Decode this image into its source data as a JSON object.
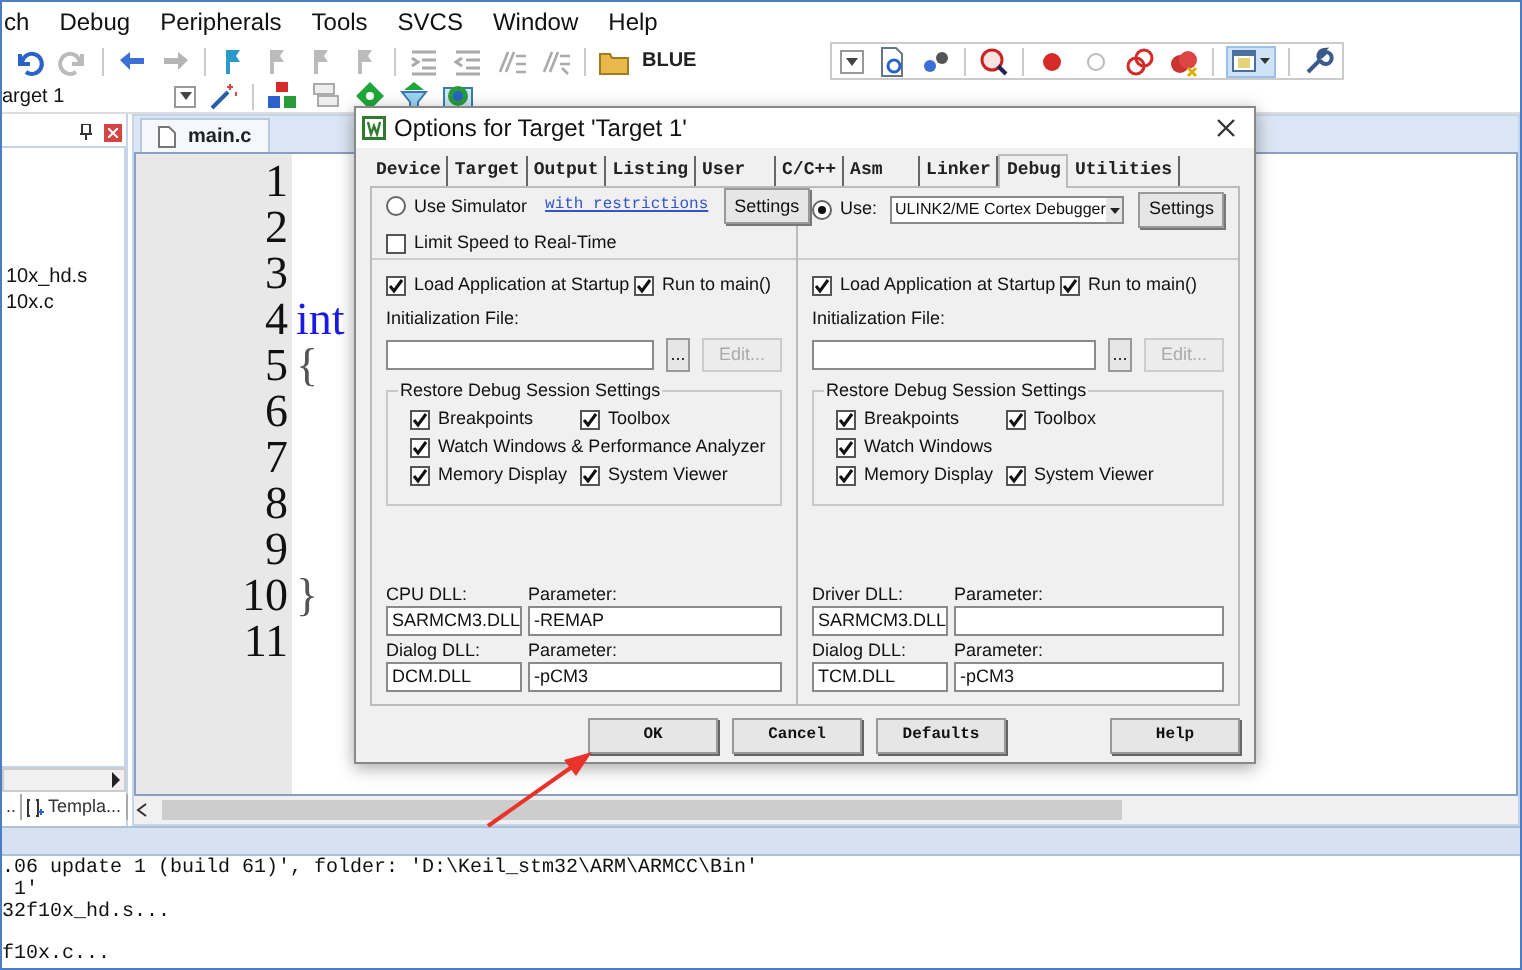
{
  "menu": [
    "ch",
    "Debug",
    "Peripherals",
    "Tools",
    "SVCS",
    "Window",
    "Help"
  ],
  "toolbar": {
    "target_label": "BLUE"
  },
  "target_select": {
    "value": "arget 1"
  },
  "project_panel": {
    "files": [
      "10x_hd.s",
      "10x.c"
    ],
    "tabs": [
      "..",
      "Templa..."
    ]
  },
  "editor": {
    "tab": "main.c",
    "lines": [
      {
        "number": "1"
      },
      {
        "number": "2"
      },
      {
        "number": "3"
      },
      {
        "number": "4",
        "code": "int",
        "kind": "keyword"
      },
      {
        "number": "5",
        "code": "{",
        "kind": "punct"
      },
      {
        "number": "6"
      },
      {
        "number": "7"
      },
      {
        "number": "8"
      },
      {
        "number": "9"
      },
      {
        "number": "10",
        "code": "}",
        "kind": "punct"
      },
      {
        "number": "11"
      }
    ]
  },
  "output": {
    "lines": [
      ".06 update 1 (build 61)', folder: 'D:\\Keil_stm32\\ARM\\ARMCC\\Bin'",
      " 1'",
      "32f10x_hd.s...",
      "f10x.c..."
    ]
  },
  "dialog": {
    "title": "Options for Target 'Target 1'",
    "tabs": [
      {
        "label": "Device",
        "selected": false
      },
      {
        "label": "Target",
        "selected": false
      },
      {
        "label": "Output",
        "selected": false
      },
      {
        "label": "Listing",
        "selected": false
      },
      {
        "label": "User",
        "selected": false
      },
      {
        "label": "C/C++",
        "selected": false
      },
      {
        "label": "Asm",
        "selected": false
      },
      {
        "label": "Linker",
        "selected": false
      },
      {
        "label": "Debug",
        "selected": true
      },
      {
        "label": "Utilities",
        "selected": false
      }
    ],
    "panes": [
      {
        "kind": "simulator",
        "radio": {
          "label": "Use Simulator",
          "selected": false
        },
        "link": "with restrictions",
        "settings": "Settings",
        "limit_speed": {
          "label": "Limit Speed to Real-Time",
          "checked": false
        },
        "load_app": {
          "label": "Load Application at Startup",
          "checked": true
        },
        "run_main": {
          "label": "Run to main()",
          "checked": true
        },
        "init_label": "Initialization File:",
        "browse": "...",
        "edit": {
          "label": "Edit...",
          "disabled": true
        },
        "restore": {
          "title": "Restore Debug Session Settings",
          "rows": [
            [
              {
                "label": "Breakpoints",
                "checked": true
              },
              {
                "label": "Toolbox",
                "checked": true
              }
            ],
            [
              {
                "label": "Watch Windows & Performance Analyzer",
                "checked": true
              }
            ],
            [
              {
                "label": "Memory Display",
                "checked": true
              },
              {
                "label": "System Viewer",
                "checked": true
              }
            ]
          ]
        },
        "dlls": [
          {
            "label": "CPU DLL:",
            "value": "SARMCM3.DLL",
            "param_label": "Parameter:",
            "param": "-REMAP"
          },
          {
            "label": "Dialog DLL:",
            "value": "DCM.DLL",
            "param_label": "Parameter:",
            "param": "-pCM3"
          }
        ]
      },
      {
        "kind": "target",
        "radio": {
          "label": "Use:",
          "selected": true
        },
        "driver": "ULINK2/ME Cortex Debugger",
        "settings": "Settings",
        "load_app": {
          "label": "Load Application at Startup",
          "checked": true
        },
        "run_main": {
          "label": "Run to main()",
          "checked": true
        },
        "init_label": "Initialization File:",
        "browse": "...",
        "edit": {
          "label": "Edit...",
          "disabled": true
        },
        "restore": {
          "title": "Restore Debug Session Settings",
          "rows": [
            [
              {
                "label": "Breakpoints",
                "checked": true
              },
              {
                "label": "Toolbox",
                "checked": true
              }
            ],
            [
              {
                "label": "Watch Windows",
                "checked": true
              }
            ],
            [
              {
                "label": "Memory Display",
                "checked": true
              },
              {
                "label": "System Viewer",
                "checked": true
              }
            ]
          ]
        },
        "dlls": [
          {
            "label": "Driver DLL:",
            "value": "SARMCM3.DLL",
            "param_label": "Parameter:"
          },
          {
            "label": "Dialog DLL:",
            "value": "TCM.DLL",
            "param_label": "Parameter:",
            "param": "-pCM3"
          }
        ]
      }
    ],
    "buttons": [
      "OK",
      "Cancel",
      "Defaults",
      "Help"
    ]
  }
}
